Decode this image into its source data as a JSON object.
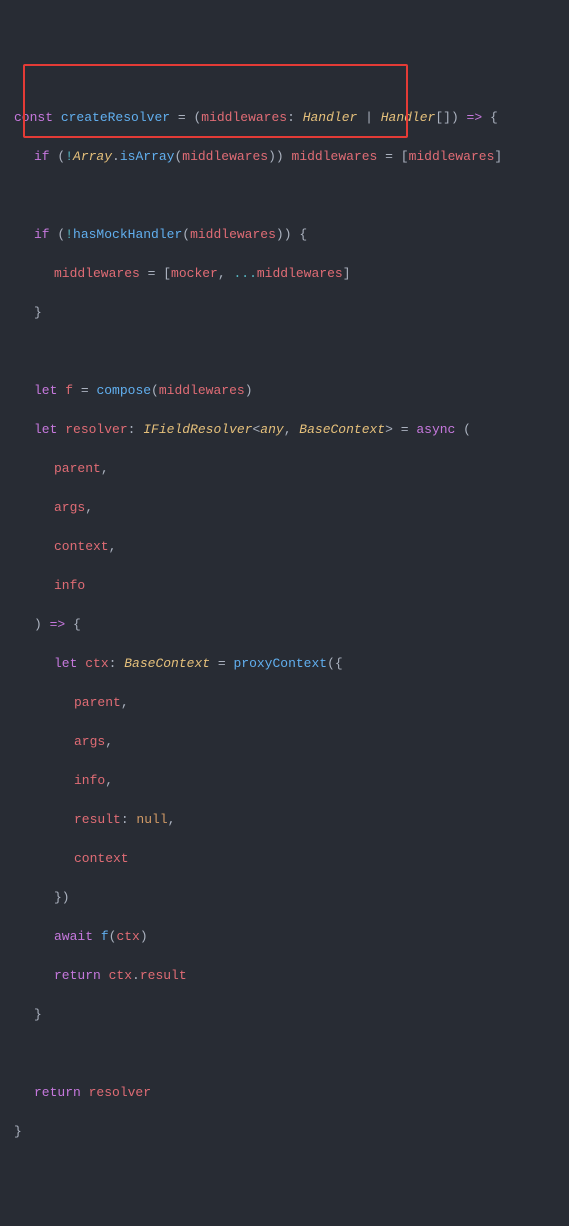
{
  "code": {
    "l1": {
      "const": "const",
      "name": "createResolver",
      "eq": " = ",
      "paren1": "(",
      "param": "middlewares",
      "colon": ": ",
      "t1": "Handler",
      "pipe": " | ",
      "t2": "Handler",
      "arr": "[]",
      "paren2": ")",
      "arrow": " => ",
      "brace": "{"
    },
    "l2": {
      "if": "if",
      "sp": " (",
      "not": "!",
      "cls": "Array",
      "dot": ".",
      "fn": "isArray",
      "open": "(",
      "arg": "middlewares",
      "close": "))",
      "sp2": " ",
      "lhs": "middlewares",
      "eq": " = ",
      "br1": "[",
      "rhs": "middlewares",
      "br2": "]"
    },
    "l4": {
      "if": "if",
      "sp": " (",
      "not": "!",
      "fn": "hasMockHandler",
      "open": "(",
      "arg": "middlewares",
      "close": "))",
      "sp2": " ",
      "brace": "{"
    },
    "l5": {
      "lhs": "middlewares",
      "eq": " = ",
      "br1": "[",
      "m": "mocker",
      "comma": ", ",
      "spread": "...",
      "rhs": "middlewares",
      "br2": "]"
    },
    "l6": {
      "brace": "}"
    },
    "l8": {
      "let": "let",
      "sp": " ",
      "f": "f",
      "eq": " = ",
      "fn": "compose",
      "open": "(",
      "arg": "middlewares",
      "close": ")"
    },
    "l9": {
      "let": "let",
      "sp": " ",
      "name": "resolver",
      "colon": ": ",
      "type": "IFieldResolver",
      "lt": "<",
      "any": "any",
      "comma": ", ",
      "bc": "BaseContext",
      "gt": ">",
      "eq": " = ",
      "async": "async",
      "sp2": " ",
      "paren": "("
    },
    "l10": {
      "p": "parent",
      "c": ","
    },
    "l11": {
      "p": "args",
      "c": ","
    },
    "l12": {
      "p": "context",
      "c": ","
    },
    "l13": {
      "p": "info"
    },
    "l14": {
      "paren": ")",
      "arrow": " => ",
      "brace": "{"
    },
    "l15": {
      "let": "let",
      "sp": " ",
      "name": "ctx",
      "colon": ": ",
      "type": "BaseContext",
      "eq": " = ",
      "fn": "proxyContext",
      "open": "(",
      "brace": "{"
    },
    "l16": {
      "p": "parent",
      "c": ","
    },
    "l17": {
      "p": "args",
      "c": ","
    },
    "l18": {
      "p": "info",
      "c": ","
    },
    "l19": {
      "p": "result",
      "colon": ": ",
      "null": "null",
      "c": ","
    },
    "l20": {
      "p": "context"
    },
    "l21": {
      "close": "})"
    },
    "l22": {
      "await": "await",
      "sp": " ",
      "fn": "f",
      "open": "(",
      "arg": "ctx",
      "close": ")"
    },
    "l23": {
      "return": "return",
      "sp": " ",
      "obj": "ctx",
      "dot": ".",
      "prop": "result"
    },
    "l24": {
      "brace": "}"
    },
    "l26": {
      "return": "return",
      "sp": " ",
      "name": "resolver"
    },
    "l27": {
      "brace": "}"
    }
  }
}
